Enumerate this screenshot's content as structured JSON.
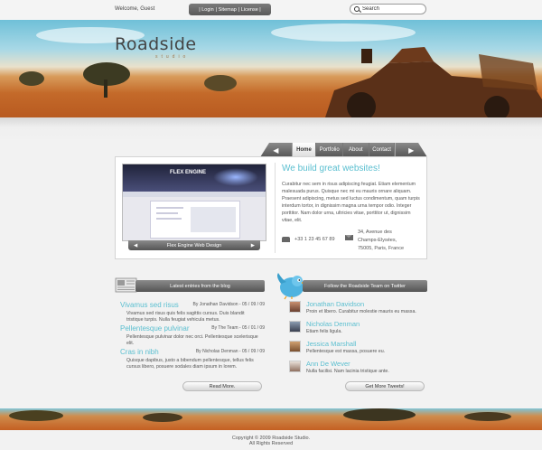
{
  "topbar": {
    "welcome": "Welcome, Guest",
    "links": [
      "| Login",
      "| Sitemap",
      "| License |"
    ],
    "search_placeholder": "Search"
  },
  "header": {
    "brand": "Roadside",
    "brand_sub": "studio"
  },
  "nav": {
    "prev": "◀",
    "items": [
      "Home",
      "Portfolio",
      "About",
      "Contact"
    ],
    "active": "Home",
    "next": "▶"
  },
  "feature": {
    "shot_logo": "FLEX ENGINE",
    "caption_prev": "◀",
    "caption": "Flex Engine Web Design",
    "caption_next": "▶",
    "title": "We build great websites!",
    "body": "Curabitur nec sem in risus adipiscing feugiat. Etiam elementum malesuada purus. Quisque nec mi eu mauris ornare aliquam. Praesent adipiscing, metus sed luctus condimentum, quam turpis interdum tortor, in dignissim magna urna tempor odio. Integer porttitor. Nam dolor urna, ultricies vitae, porttitor ut, dignissim vitae, elit.",
    "phone": "+33 1 23 45 67 89",
    "address": "34, Avenue des Champs-Elysées, 75005, Paris, France"
  },
  "blog": {
    "header": "Latest entries from the blog",
    "button": "Read More.",
    "entries": [
      {
        "title": "Vivamus sed risus",
        "meta": "By Jonathan Davidson - 05 / 09 / 09",
        "text": "Vivamus sed risus quis felis sagittis cursus. Duis blandit tristique turpis. Nulla feugiat vehicula metus."
      },
      {
        "title": "Pellentesque pulvinar",
        "meta": "By The Team - 05 / 01 / 09",
        "text": "Pellentesque pulvinar dolor nec orci. Pellentesque scelerisque elit."
      },
      {
        "title": "Cras in nibh",
        "meta": "By Nicholas Denman - 05 / 09 / 09",
        "text": "Quisque dapibus, justo a bibendum pellentesque, tellus felis cursus libero, posuere sodales diam ipsum in lorem."
      }
    ]
  },
  "twitter": {
    "header": "Follow the Roadside Team on Twitter",
    "button": "Get More Tweets!",
    "tweets": [
      {
        "name": "Jonathan Davidson",
        "text": "Proin et libero. Curabitur molestie mauris eu massa."
      },
      {
        "name": "Nicholas Denman",
        "text": "Etiam felis ligula."
      },
      {
        "name": "Jessica Marshall",
        "text": "Pellentesque est massa, posuere eu."
      },
      {
        "name": "Ann De Wever",
        "text": "Nulla facilisi. Nam lacinia tristique ante."
      }
    ]
  },
  "footer": {
    "line1": "Copyright © 2009 Roadside Studio.",
    "line2": "All Rights Reserved"
  },
  "colors": {
    "accent": "#5bbfd0",
    "nav_dark": "#555555",
    "sand": "#c46a2a"
  }
}
